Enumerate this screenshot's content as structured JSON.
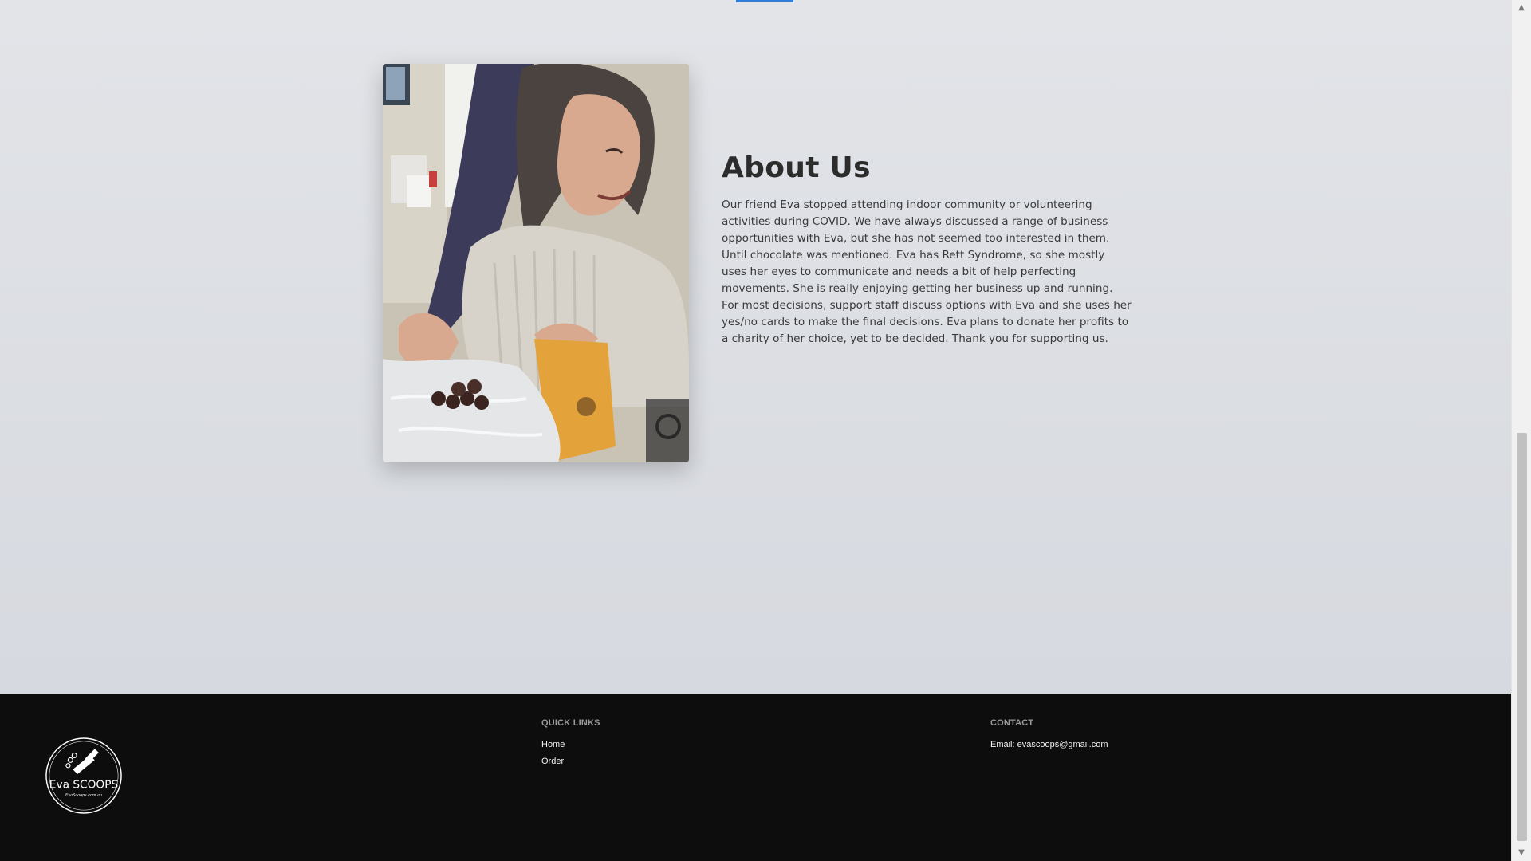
{
  "about": {
    "heading": "About Us",
    "body": "Our friend Eva stopped attending indoor community or volunteering activities during COVID. We have always discussed a range of business opportunities with Eva, but she has not seemed too interested in them. Until chocolate was mentioned. Eva has Rett Syndrome, so she mostly uses her eyes to communicate and needs a bit of help perfecting movements. She is really enjoying getting her business up and running. For most decisions, support staff discuss options with Eva and she uses her yes/no cards to make the final decisions. Eva plans to donate her profits to a charity of her choice, yet to be decided. Thank you for supporting us."
  },
  "footer": {
    "logo_text": "Eva SCOOPS",
    "logo_subtext": "EvaScoops.com.au",
    "quick_links": {
      "title": "QUICK LINKS",
      "links": [
        "Home",
        "Order"
      ]
    },
    "contact": {
      "title": "CONTACT",
      "email": "Email: evascoops@gmail.com"
    }
  },
  "colors": {
    "accent": "#2f7ed8",
    "footer_bg": "#0d0d0e",
    "page_bg": "#dcdfe4"
  },
  "scrollbar": {
    "up_icon": "▲",
    "down_icon": "▼"
  }
}
